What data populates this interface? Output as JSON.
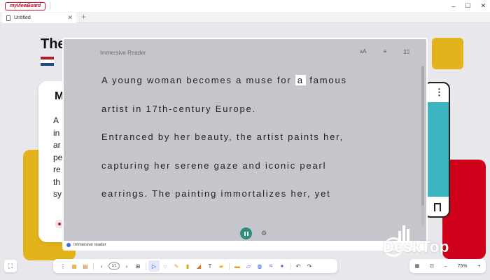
{
  "app": {
    "logo_text": "myViewBoard",
    "window_controls": {
      "minimize": "–",
      "maximize": "☐",
      "close": "✕"
    }
  },
  "tabs": [
    {
      "label": "Untitled",
      "close": "✕"
    }
  ],
  "tab_add": "+",
  "background": {
    "title": "The",
    "card_heading": "M",
    "card_letters": [
      "A",
      "in",
      "ar",
      "pe",
      "re",
      "th",
      "sy"
    ],
    "flag_colors": [
      "#ae1c28",
      "#ffffff",
      "#21468b"
    ]
  },
  "reader": {
    "title": "Immersive Reader",
    "tools": {
      "text_size": "ᴀA",
      "grammar": "≡",
      "book": "▯▯"
    },
    "lines": [
      {
        "before": "A young woman becomes a muse for ",
        "highlight": "a",
        "after": " famous"
      },
      {
        "before": "artist in 17th-century Europe.",
        "highlight": "",
        "after": ""
      },
      {
        "before": "Entranced by her beauty, the artist paints her,",
        "highlight": "",
        "after": ""
      },
      {
        "before": "capturing her serene gaze and iconic pearl",
        "highlight": "",
        "after": ""
      },
      {
        "before": "earrings. The painting immortalizes her, yet",
        "highlight": "",
        "after": ""
      }
    ],
    "status_label": "Immersive reader",
    "accent_color": "#2e8c7d"
  },
  "toolbar": {
    "page_indicator": "1/1",
    "zoom_level": "75%",
    "zoom_minus": "–",
    "zoom_plus": "+"
  },
  "watermark": {
    "text": "DeskTop"
  }
}
